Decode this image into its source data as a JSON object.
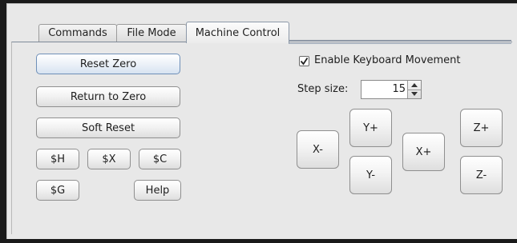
{
  "tabs": [
    {
      "label": "Commands",
      "active": false
    },
    {
      "label": "File Mode",
      "active": false
    },
    {
      "label": "Machine Control",
      "active": true
    }
  ],
  "buttons": {
    "reset_zero": "Reset Zero",
    "return_to_zero": "Return to Zero",
    "soft_reset": "Soft Reset",
    "h": "$H",
    "x": "$X",
    "c": "$C",
    "g": "$G",
    "help": "Help"
  },
  "keyboard": {
    "enable_label": "Enable Keyboard Movement",
    "checked": true,
    "step_label": "Step size:",
    "step_value": "15"
  },
  "jog": {
    "x_minus": "X-",
    "x_plus": "X+",
    "y_plus": "Y+",
    "y_minus": "Y-",
    "z_plus": "Z+",
    "z_minus": "Z-"
  },
  "colors": {
    "accent": "#6e8fb8",
    "window": "#e8e8e8"
  }
}
